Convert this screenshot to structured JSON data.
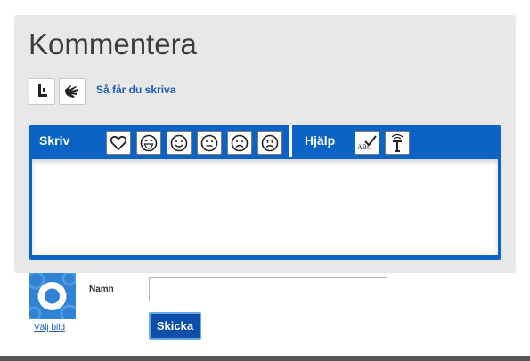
{
  "comment": {
    "title": "Kommentera",
    "help_link": "Så får du skriva",
    "tools": [
      {
        "icon": "sign-language-icon"
      },
      {
        "icon": "hand-sign-icon"
      }
    ]
  },
  "editor": {
    "write_label": "Skriv",
    "help_label": "Hjälp",
    "emoticons": [
      "heart-icon",
      "laughing-face-icon",
      "smiling-face-icon",
      "neutral-face-icon",
      "sad-face-icon",
      "angry-face-icon"
    ],
    "help_tools": [
      "spellcheck-abc-icon",
      "text-to-speech-icon"
    ],
    "text_value": ""
  },
  "form": {
    "avatar_link": "Välj bild",
    "name_label": "Namn",
    "name_value": "",
    "submit_label": "Skicka"
  },
  "colors": {
    "panel": "#e9e8e9",
    "editor_blue": "#0b63c6",
    "link": "#1f5db0",
    "button": "#0b4fa8"
  }
}
